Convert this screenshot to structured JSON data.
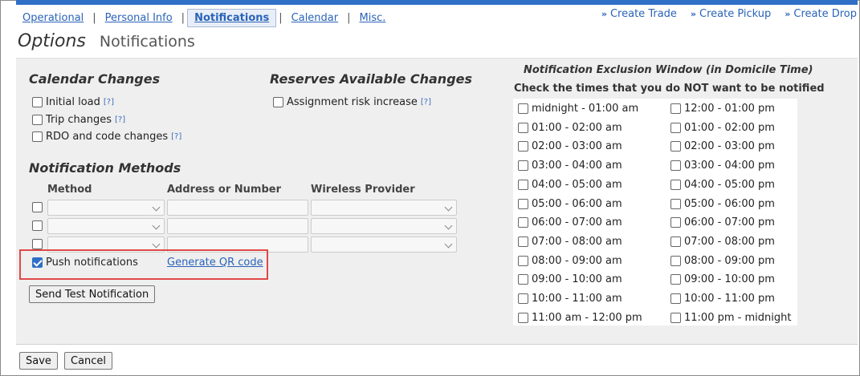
{
  "nav": {
    "tabs": [
      {
        "label": "Operational"
      },
      {
        "label": "Personal Info"
      },
      {
        "label": "Notifications"
      },
      {
        "label": "Calendar"
      },
      {
        "label": "Misc."
      }
    ],
    "separator": "|",
    "active_tab": "Notifications",
    "quick_links": [
      {
        "label": "Create Trade"
      },
      {
        "label": "Create Pickup"
      },
      {
        "label": "Create Drop"
      }
    ],
    "quick_link_icon": "»"
  },
  "header": {
    "title": "Options",
    "subtitle": "Notifications"
  },
  "calendar_changes": {
    "heading": "Calendar Changes",
    "items": [
      {
        "label": "Initial load",
        "help": "[?]",
        "checked": false
      },
      {
        "label": "Trip changes",
        "help": "[?]",
        "checked": false
      },
      {
        "label": "RDO and code changes",
        "help": "[?]",
        "checked": false
      }
    ]
  },
  "reserves": {
    "heading": "Reserves Available Changes",
    "items": [
      {
        "label": "Assignment risk increase",
        "help": "[?]",
        "checked": false
      }
    ]
  },
  "methods": {
    "heading": "Notification Methods",
    "columns": {
      "method": "Method",
      "address": "Address or Number",
      "provider": "Wireless Provider"
    },
    "rows": [
      {
        "method": "",
        "address": "",
        "provider": "",
        "checked": false
      },
      {
        "method": "",
        "address": "",
        "provider": "",
        "checked": false
      },
      {
        "method": "",
        "address": "",
        "provider": "",
        "checked": false
      }
    ],
    "push": {
      "label": "Push notifications",
      "checked": true
    },
    "qr_link": "Generate QR code",
    "test_button": "Send Test Notification"
  },
  "exclusion": {
    "title": "Notification Exclusion Window (in Domicile Time)",
    "subtitle": "Check the times that you do NOT want to be notified",
    "left": [
      "midnight - 01:00 am",
      "01:00 - 02:00 am",
      "02:00 - 03:00 am",
      "03:00 - 04:00 am",
      "04:00 - 05:00 am",
      "05:00 - 06:00 am",
      "06:00 - 07:00 am",
      "07:00 - 08:00 am",
      "08:00 - 09:00 am",
      "09:00 - 10:00 am",
      "10:00 - 11:00 am",
      "11:00 am - 12:00 pm"
    ],
    "right": [
      "12:00 - 01:00 pm",
      "01:00 - 02:00 pm",
      "02:00 - 03:00 pm",
      "03:00 - 04:00 pm",
      "04:00 - 05:00 pm",
      "05:00 - 06:00 pm",
      "06:00 - 07:00 pm",
      "07:00 - 08:00 pm",
      "08:00 - 09:00 pm",
      "09:00 - 10:00 pm",
      "10:00 - 11:00 pm",
      "11:00 pm - midnight"
    ]
  },
  "footer": {
    "save": "Save",
    "cancel": "Cancel"
  },
  "colors": {
    "accent": "#2f6fc6",
    "link": "#2a63b8",
    "highlight": "#e04848",
    "panel": "#efefef"
  }
}
